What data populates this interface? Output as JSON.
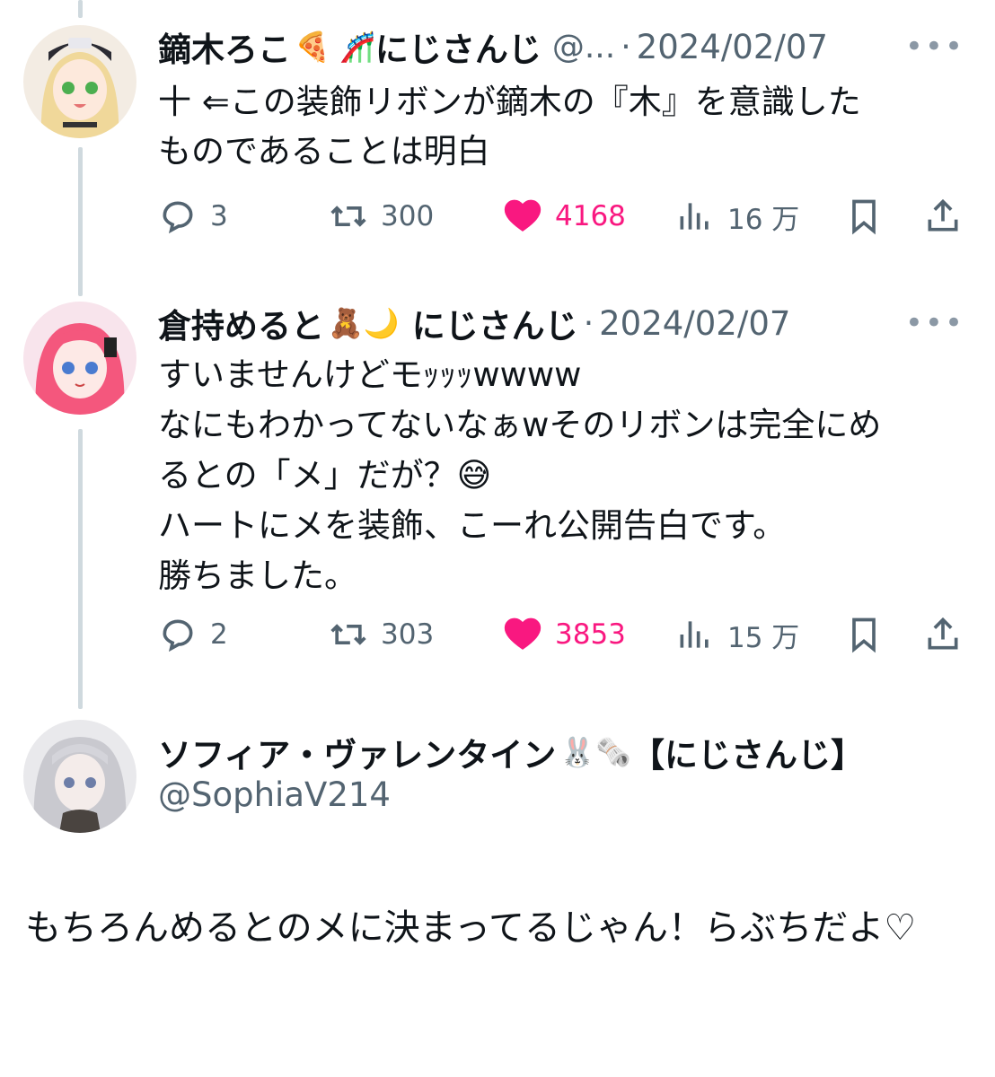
{
  "tweets": [
    {
      "name": "鏑木ろこ",
      "emoji": "🍕 🎢",
      "org": "にじさんじ",
      "handle": "@...",
      "date": "2024/02/07",
      "text": "十 ⇐この装飾リボンが鏑木の『木』を意識した\nものであることは明白",
      "replies": "3",
      "retweets": "300",
      "likes": "4168",
      "views": "16 万"
    },
    {
      "name": "倉持めると",
      "emoji": "🧸🌙",
      "org": "にじさんじ",
      "handle": "",
      "date": "2024/02/07",
      "text": "すいませんけどモｯｯｯwwww\nなにもわかってないなぁwそのリボンは完全にめ\nるとの「メ」だが？😅\nハートにメを装飾、こーれ公開告白です。\n勝ちました。",
      "replies": "2",
      "retweets": "303",
      "likes": "3853",
      "views": "15 万"
    }
  ],
  "main_tweet": {
    "name": "ソフィア・ヴァレンタイン",
    "emoji": "🐰🗞️",
    "org": "【にじさんじ】",
    "handle": "@SophiaV214",
    "text": "もちろんめるとのメに決まってるじゃん！らぶちだよ♡"
  },
  "icons": {
    "reply": "reply-icon",
    "retweet": "retweet-icon",
    "like": "heart-icon",
    "views": "views-icon",
    "bookmark": "bookmark-icon",
    "share": "share-icon",
    "more": "more-icon"
  },
  "colors": {
    "like": "#f91880",
    "muted": "#536471",
    "thread_line": "#cfd9de"
  }
}
